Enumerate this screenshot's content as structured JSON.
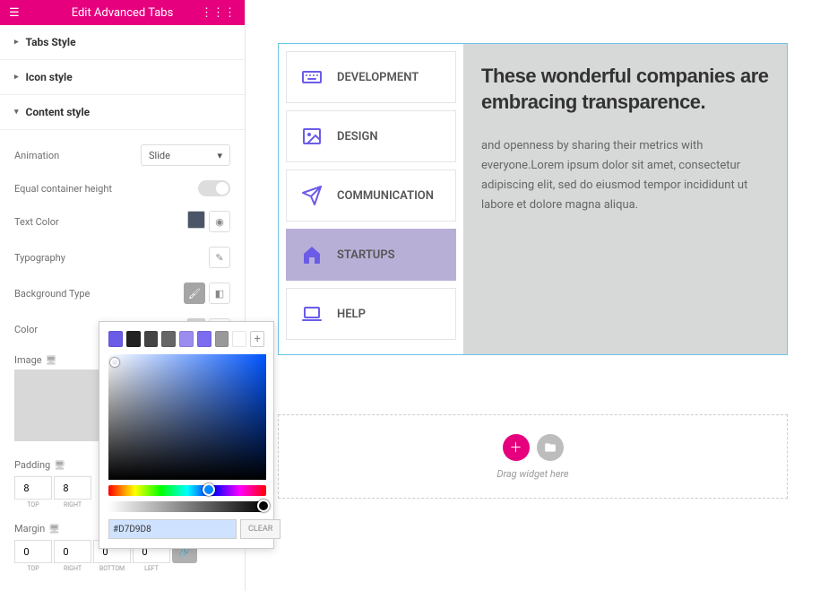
{
  "header": {
    "title": "Edit Advanced Tabs"
  },
  "sections": {
    "tabs_style": "Tabs Style",
    "icon_style": "Icon style",
    "content_style": "Content style"
  },
  "controls": {
    "animation": {
      "label": "Animation",
      "value": "Slide"
    },
    "equal_height": {
      "label": "Equal container height",
      "value": "NO"
    },
    "text_color": {
      "label": "Text Color",
      "value": "#4a5568"
    },
    "typography": {
      "label": "Typography"
    },
    "bg_type": {
      "label": "Background Type"
    },
    "color": {
      "label": "Color"
    },
    "image": {
      "label": "Image"
    },
    "padding": {
      "label": "Padding",
      "top": "8",
      "right": "8",
      "lbl_top": "TOP",
      "lbl_right": "RIGHT"
    },
    "margin": {
      "label": "Margin",
      "top": "0",
      "right": "0",
      "bottom": "0",
      "left": "0",
      "lbl_top": "TOP",
      "lbl_right": "RIGHT",
      "lbl_bottom": "BOTTOM",
      "lbl_left": "LEFT"
    }
  },
  "colorpicker": {
    "swatches": [
      "#6b5ce7",
      "#222222",
      "#444444",
      "#666666",
      "#9b8cf0",
      "#7b6cf0",
      "#999999",
      "#ffffff"
    ],
    "hex": "#D7D9D8",
    "clear": "CLEAR"
  },
  "preview": {
    "tabs": [
      {
        "icon": "keyboard",
        "label": "DEVELOPMENT"
      },
      {
        "icon": "image",
        "label": "DESIGN"
      },
      {
        "icon": "send",
        "label": "COMMUNICATION"
      },
      {
        "icon": "home",
        "label": "STARTUPS",
        "active": true
      },
      {
        "icon": "laptop",
        "label": "HELP"
      }
    ],
    "heading": "These wonderful companies are embracing transparence.",
    "body": "and openness by sharing their metrics with everyone.Lorem ipsum dolor sit amet, consectetur adipiscing elit, sed do eiusmod tempor incididunt ut labore et dolore magna aliqua."
  },
  "dropzone": {
    "text": "Drag widget here"
  }
}
